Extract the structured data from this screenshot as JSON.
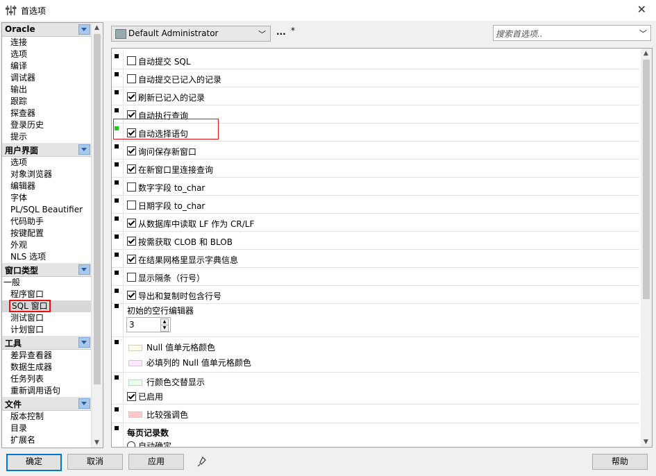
{
  "window": {
    "title": "首选项",
    "close_glyph": "✕"
  },
  "nav": {
    "categories": [
      {
        "label": "Oracle",
        "items": [
          "连接",
          "选项",
          "编译",
          "调试器",
          "输出",
          "跟踪",
          "探查器",
          "登录历史",
          "提示"
        ]
      },
      {
        "label": "用户界面",
        "items": [
          "选项",
          "对象浏览器",
          "编辑器",
          "字体",
          "PL/SQL Beautifier",
          "代码助手",
          "按键配置",
          "外观",
          "NLS 选项"
        ]
      },
      {
        "label": "窗口类型",
        "items": [
          "一般",
          "程序窗口",
          "SQL 窗口",
          "测试窗口",
          "计划窗口"
        ],
        "selected": "SQL 窗口"
      },
      {
        "label": "工具",
        "items": [
          "差异查看器",
          "数据生成器",
          "任务列表",
          "重新调用语句"
        ]
      },
      {
        "label": "文件",
        "items": [
          "版本控制",
          "目录",
          "扩展名"
        ]
      }
    ]
  },
  "toolbar": {
    "profile": "Default Administrator",
    "more": "...",
    "modified_marker": "*",
    "search_placeholder": "搜索首选项.."
  },
  "options": {
    "checkboxes": [
      {
        "label": "自动提交 SQL",
        "checked": false
      },
      {
        "label": "自动提交已记入的记录",
        "checked": false
      },
      {
        "label": "刷新已记入的记录",
        "checked": true
      },
      {
        "label": "自动执行查询",
        "checked": true
      },
      {
        "label": "自动选择语句",
        "checked": true,
        "highlighted": true
      },
      {
        "label": "询问保存新窗口",
        "checked": true
      },
      {
        "label": "在新窗口里连接查询",
        "checked": true
      },
      {
        "label": "数字字段 to_char",
        "checked": false
      },
      {
        "label": "日期字段 to_char",
        "checked": false
      },
      {
        "label": "从数据库中读取 LF 作为 CR/LF",
        "checked": true
      },
      {
        "label": "按需获取 CLOB 和 BLOB",
        "checked": true
      },
      {
        "label": "在结果网格里显示字典信息",
        "checked": true
      },
      {
        "label": "显示隔条（行号）",
        "checked": false
      },
      {
        "label": "导出和复制时包含行号",
        "checked": true
      }
    ],
    "empty_rows_label": "初始的空行编辑器",
    "empty_rows_value": "3",
    "null_color_label": "Null 值单元格颜色",
    "required_null_color_label": "必填列的 Null 值单元格颜色",
    "alt_row_label": "行颜色交替显示",
    "enabled_label": "已启用",
    "enabled_checked": true,
    "contrast_label": "比较强调色",
    "records_per_page_label": "每页记录数",
    "auto_adjust_label": "自动确定",
    "colors": {
      "null": "#ffffe8",
      "required_null": "#ffe8ff",
      "alt_row": "#e8ffe8",
      "contrast": "#ffc8c8"
    }
  },
  "buttons": {
    "ok": "确定",
    "cancel": "取消",
    "apply": "应用",
    "help": "帮助"
  },
  "colors": {
    "highlight_box": "#e81010",
    "default_button_border": "#0078d7",
    "modified_marker_green": "#22c822"
  }
}
